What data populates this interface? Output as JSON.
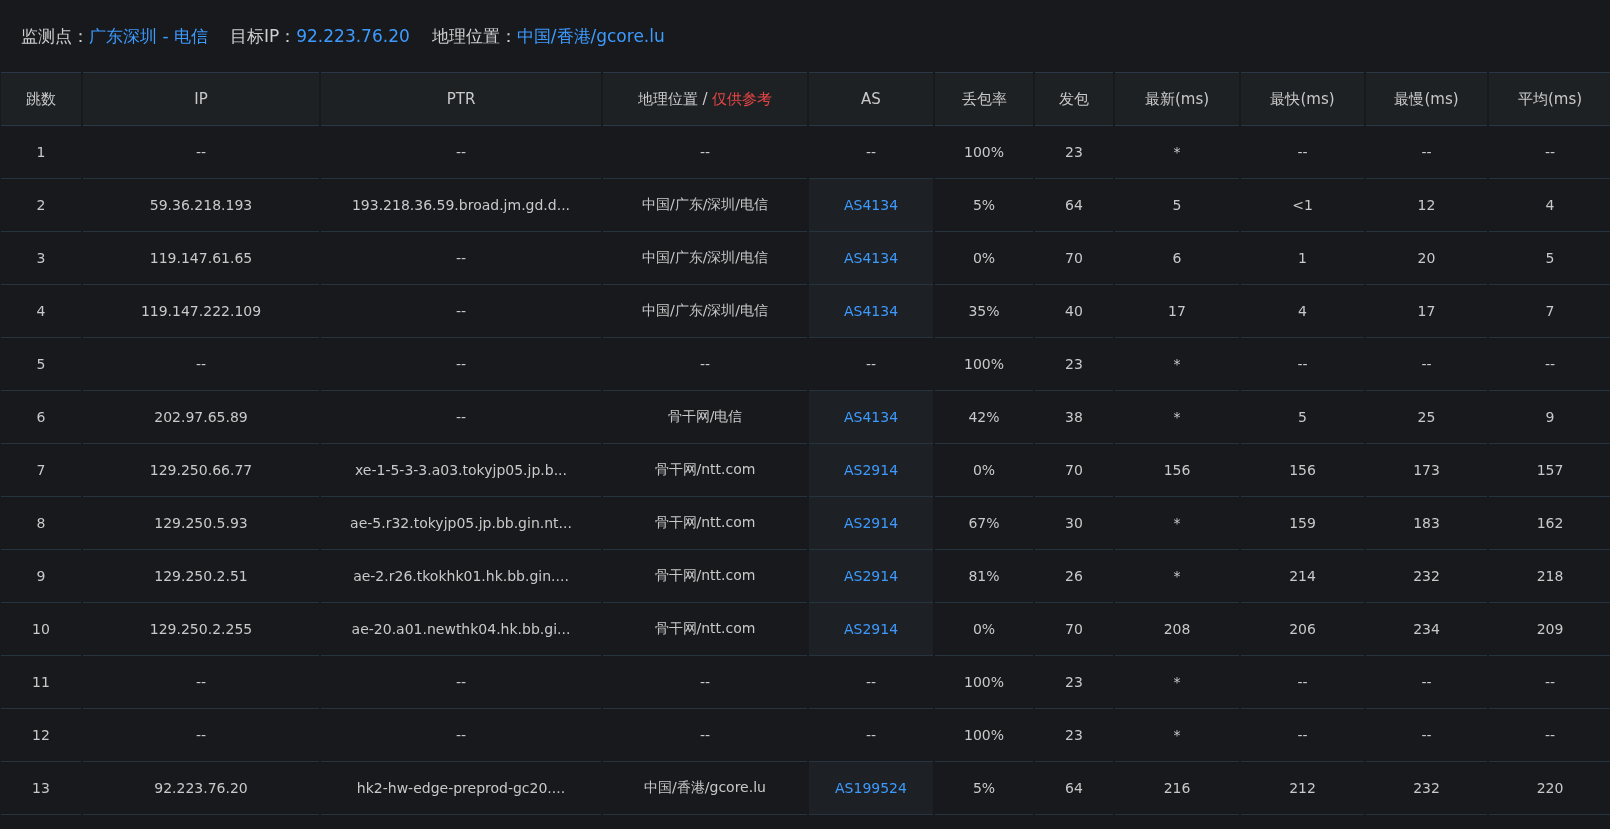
{
  "summary": [
    {
      "label": "监测点：",
      "value": "广东深圳 - 电信"
    },
    {
      "label": "目标IP：",
      "value": "92.223.76.20"
    },
    {
      "label": "地理位置：",
      "value": "中国/香港/gcore.lu"
    }
  ],
  "table": {
    "columns": [
      {
        "label": "跳数"
      },
      {
        "label": "IP"
      },
      {
        "label": "PTR"
      },
      {
        "label": "地理位置 / ",
        "note": "仅供参考"
      },
      {
        "label": "AS"
      },
      {
        "label": "丢包率"
      },
      {
        "label": "发包"
      },
      {
        "label": "最新(ms)"
      },
      {
        "label": "最快(ms)"
      },
      {
        "label": "最慢(ms)"
      },
      {
        "label": "平均(ms)"
      }
    ],
    "rows": [
      {
        "hop": "1",
        "ip": "--",
        "ptr": "--",
        "geo": "--",
        "as": "--",
        "as_linked": false,
        "loss": "100%",
        "sent": "23",
        "last": "*",
        "best": "--",
        "worst": "--",
        "avg": "--"
      },
      {
        "hop": "2",
        "ip": "59.36.218.193",
        "ptr": "193.218.36.59.broad.jm.gd.d...",
        "geo": "中国/广东/深圳/电信",
        "as": "AS4134",
        "as_linked": true,
        "loss": "5%",
        "sent": "64",
        "last": "5",
        "best": "<1",
        "worst": "12",
        "avg": "4"
      },
      {
        "hop": "3",
        "ip": "119.147.61.65",
        "ptr": "--",
        "geo": "中国/广东/深圳/电信",
        "as": "AS4134",
        "as_linked": true,
        "loss": "0%",
        "sent": "70",
        "last": "6",
        "best": "1",
        "worst": "20",
        "avg": "5"
      },
      {
        "hop": "4",
        "ip": "119.147.222.109",
        "ptr": "--",
        "geo": "中国/广东/深圳/电信",
        "as": "AS4134",
        "as_linked": true,
        "loss": "35%",
        "sent": "40",
        "last": "17",
        "best": "4",
        "worst": "17",
        "avg": "7"
      },
      {
        "hop": "5",
        "ip": "--",
        "ptr": "--",
        "geo": "--",
        "as": "--",
        "as_linked": false,
        "loss": "100%",
        "sent": "23",
        "last": "*",
        "best": "--",
        "worst": "--",
        "avg": "--"
      },
      {
        "hop": "6",
        "ip": "202.97.65.89",
        "ptr": "--",
        "geo": "骨干网/电信",
        "as": "AS4134",
        "as_linked": true,
        "loss": "42%",
        "sent": "38",
        "last": "*",
        "best": "5",
        "worst": "25",
        "avg": "9"
      },
      {
        "hop": "7",
        "ip": "129.250.66.77",
        "ptr": "xe-1-5-3-3.a03.tokyjp05.jp.b...",
        "geo": "骨干网/ntt.com",
        "as": "AS2914",
        "as_linked": true,
        "loss": "0%",
        "sent": "70",
        "last": "156",
        "best": "156",
        "worst": "173",
        "avg": "157"
      },
      {
        "hop": "8",
        "ip": "129.250.5.93",
        "ptr": "ae-5.r32.tokyjp05.jp.bb.gin.nt...",
        "geo": "骨干网/ntt.com",
        "as": "AS2914",
        "as_linked": true,
        "loss": "67%",
        "sent": "30",
        "last": "*",
        "best": "159",
        "worst": "183",
        "avg": "162"
      },
      {
        "hop": "9",
        "ip": "129.250.2.51",
        "ptr": "ae-2.r26.tkokhk01.hk.bb.gin....",
        "geo": "骨干网/ntt.com",
        "as": "AS2914",
        "as_linked": true,
        "loss": "81%",
        "sent": "26",
        "last": "*",
        "best": "214",
        "worst": "232",
        "avg": "218"
      },
      {
        "hop": "10",
        "ip": "129.250.2.255",
        "ptr": "ae-20.a01.newthk04.hk.bb.gi...",
        "geo": "骨干网/ntt.com",
        "as": "AS2914",
        "as_linked": true,
        "loss": "0%",
        "sent": "70",
        "last": "208",
        "best": "206",
        "worst": "234",
        "avg": "209"
      },
      {
        "hop": "11",
        "ip": "--",
        "ptr": "--",
        "geo": "--",
        "as": "--",
        "as_linked": false,
        "loss": "100%",
        "sent": "23",
        "last": "*",
        "best": "--",
        "worst": "--",
        "avg": "--"
      },
      {
        "hop": "12",
        "ip": "--",
        "ptr": "--",
        "geo": "--",
        "as": "--",
        "as_linked": false,
        "loss": "100%",
        "sent": "23",
        "last": "*",
        "best": "--",
        "worst": "--",
        "avg": "--"
      },
      {
        "hop": "13",
        "ip": "92.223.76.20",
        "ptr": "hk2-hw-edge-preprod-gc20....",
        "geo": "中国/香港/gcore.lu",
        "as": "AS199524",
        "as_linked": true,
        "loss": "5%",
        "sent": "64",
        "last": "216",
        "best": "212",
        "worst": "232",
        "avg": "220"
      }
    ]
  }
}
